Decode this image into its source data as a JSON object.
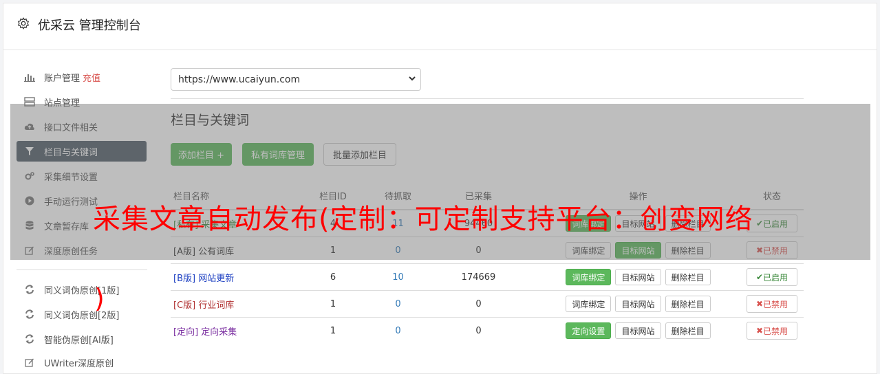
{
  "app": {
    "title": "优采云 管理控制台"
  },
  "sidebar": {
    "items": [
      {
        "label": "账户管理",
        "extra": "充值",
        "icon": "bar-chart-icon"
      },
      {
        "label": "站点管理",
        "icon": "server-icon"
      },
      {
        "label": "接口文件相关",
        "icon": "cloud-upload-icon"
      },
      {
        "label": "栏目与关键词",
        "icon": "filter-icon",
        "active": true
      },
      {
        "label": "采集细节设置",
        "icon": "cogs-icon"
      },
      {
        "label": "手动运行测试",
        "icon": "play-circle-icon"
      },
      {
        "label": "文章暂存库",
        "icon": "database-icon"
      },
      {
        "label": "深度原创任务",
        "icon": "edit-icon"
      }
    ],
    "tools": [
      {
        "label": "同义词伪原创[1版]",
        "icon": "refresh-icon"
      },
      {
        "label": "同义词伪原创[2版]",
        "icon": "refresh-icon"
      },
      {
        "label": "智能伪原创[AI版]",
        "icon": "refresh-icon"
      },
      {
        "label": "UWriter深度原创",
        "icon": "edit-icon"
      }
    ]
  },
  "site_select": {
    "value": "https://www.ucaiyun.com"
  },
  "section": {
    "title": "栏目与关键词"
  },
  "actions": {
    "add": "添加栏目 +",
    "private_lib": "私有词库管理",
    "batch_add": "批量添加栏目"
  },
  "table": {
    "headers": [
      "栏目名称",
      "栏目ID",
      "待抓取",
      "已采集",
      "操作",
      "状态"
    ],
    "rows": [
      {
        "name": "[私有] 采集文章",
        "id": "4",
        "pending": "11",
        "collected": "94460",
        "bind": "词库绑定",
        "target": "目标网站",
        "delete": "删除栏目",
        "status": "已启用"
      },
      {
        "name": "[A版] 公有词库",
        "id": "1",
        "pending": "0",
        "collected": "0",
        "bind": "词库绑定",
        "target": "目标网站",
        "delete": "删除栏目",
        "status": "已禁用"
      },
      {
        "name": "[B版] 网站更新",
        "id": "6",
        "pending": "10",
        "collected": "174669",
        "bind": "词库绑定",
        "target": "目标网站",
        "delete": "删除栏目",
        "status": "已启用"
      },
      {
        "name": "[C版] 行业词库",
        "id": "1",
        "pending": "0",
        "collected": "0",
        "bind": "词库绑定",
        "target": "目标网站",
        "delete": "删除栏目",
        "status": "已禁用"
      },
      {
        "name": "[定向] 定向采集",
        "id": "1",
        "pending": "0",
        "collected": "0",
        "bind": "定向设置",
        "target": "目标网站",
        "delete": "删除栏目",
        "status": "已禁用"
      }
    ]
  },
  "watermark": {
    "text": "采集文章自动发布(定制：可定制支持平台：创变网络",
    "paren": ")"
  },
  "colors": {
    "green": "#5cb85c",
    "active_bg": "#4f5b66",
    "red": "#d9534f",
    "blue_link": "#1a3dc1"
  }
}
